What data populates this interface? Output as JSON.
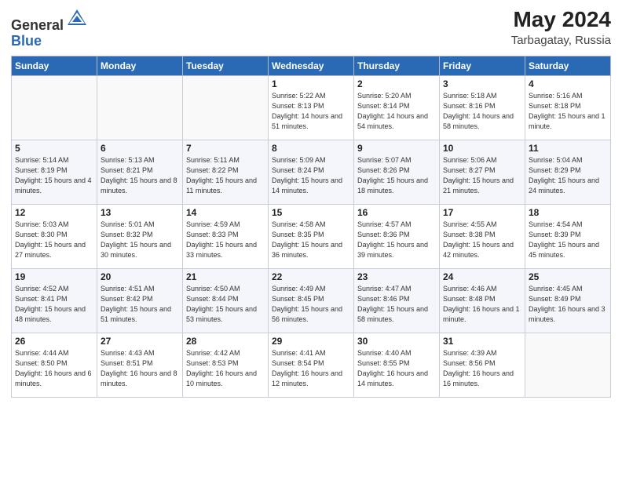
{
  "header": {
    "logo_general": "General",
    "logo_blue": "Blue",
    "month": "May 2024",
    "location": "Tarbagatay, Russia"
  },
  "days_of_week": [
    "Sunday",
    "Monday",
    "Tuesday",
    "Wednesday",
    "Thursday",
    "Friday",
    "Saturday"
  ],
  "weeks": [
    [
      {
        "day": "",
        "content": ""
      },
      {
        "day": "",
        "content": ""
      },
      {
        "day": "",
        "content": ""
      },
      {
        "day": "1",
        "content": "Sunrise: 5:22 AM\nSunset: 8:13 PM\nDaylight: 14 hours\nand 51 minutes."
      },
      {
        "day": "2",
        "content": "Sunrise: 5:20 AM\nSunset: 8:14 PM\nDaylight: 14 hours\nand 54 minutes."
      },
      {
        "day": "3",
        "content": "Sunrise: 5:18 AM\nSunset: 8:16 PM\nDaylight: 14 hours\nand 58 minutes."
      },
      {
        "day": "4",
        "content": "Sunrise: 5:16 AM\nSunset: 8:18 PM\nDaylight: 15 hours\nand 1 minute."
      }
    ],
    [
      {
        "day": "5",
        "content": "Sunrise: 5:14 AM\nSunset: 8:19 PM\nDaylight: 15 hours\nand 4 minutes."
      },
      {
        "day": "6",
        "content": "Sunrise: 5:13 AM\nSunset: 8:21 PM\nDaylight: 15 hours\nand 8 minutes."
      },
      {
        "day": "7",
        "content": "Sunrise: 5:11 AM\nSunset: 8:22 PM\nDaylight: 15 hours\nand 11 minutes."
      },
      {
        "day": "8",
        "content": "Sunrise: 5:09 AM\nSunset: 8:24 PM\nDaylight: 15 hours\nand 14 minutes."
      },
      {
        "day": "9",
        "content": "Sunrise: 5:07 AM\nSunset: 8:26 PM\nDaylight: 15 hours\nand 18 minutes."
      },
      {
        "day": "10",
        "content": "Sunrise: 5:06 AM\nSunset: 8:27 PM\nDaylight: 15 hours\nand 21 minutes."
      },
      {
        "day": "11",
        "content": "Sunrise: 5:04 AM\nSunset: 8:29 PM\nDaylight: 15 hours\nand 24 minutes."
      }
    ],
    [
      {
        "day": "12",
        "content": "Sunrise: 5:03 AM\nSunset: 8:30 PM\nDaylight: 15 hours\nand 27 minutes."
      },
      {
        "day": "13",
        "content": "Sunrise: 5:01 AM\nSunset: 8:32 PM\nDaylight: 15 hours\nand 30 minutes."
      },
      {
        "day": "14",
        "content": "Sunrise: 4:59 AM\nSunset: 8:33 PM\nDaylight: 15 hours\nand 33 minutes."
      },
      {
        "day": "15",
        "content": "Sunrise: 4:58 AM\nSunset: 8:35 PM\nDaylight: 15 hours\nand 36 minutes."
      },
      {
        "day": "16",
        "content": "Sunrise: 4:57 AM\nSunset: 8:36 PM\nDaylight: 15 hours\nand 39 minutes."
      },
      {
        "day": "17",
        "content": "Sunrise: 4:55 AM\nSunset: 8:38 PM\nDaylight: 15 hours\nand 42 minutes."
      },
      {
        "day": "18",
        "content": "Sunrise: 4:54 AM\nSunset: 8:39 PM\nDaylight: 15 hours\nand 45 minutes."
      }
    ],
    [
      {
        "day": "19",
        "content": "Sunrise: 4:52 AM\nSunset: 8:41 PM\nDaylight: 15 hours\nand 48 minutes."
      },
      {
        "day": "20",
        "content": "Sunrise: 4:51 AM\nSunset: 8:42 PM\nDaylight: 15 hours\nand 51 minutes."
      },
      {
        "day": "21",
        "content": "Sunrise: 4:50 AM\nSunset: 8:44 PM\nDaylight: 15 hours\nand 53 minutes."
      },
      {
        "day": "22",
        "content": "Sunrise: 4:49 AM\nSunset: 8:45 PM\nDaylight: 15 hours\nand 56 minutes."
      },
      {
        "day": "23",
        "content": "Sunrise: 4:47 AM\nSunset: 8:46 PM\nDaylight: 15 hours\nand 58 minutes."
      },
      {
        "day": "24",
        "content": "Sunrise: 4:46 AM\nSunset: 8:48 PM\nDaylight: 16 hours\nand 1 minute."
      },
      {
        "day": "25",
        "content": "Sunrise: 4:45 AM\nSunset: 8:49 PM\nDaylight: 16 hours\nand 3 minutes."
      }
    ],
    [
      {
        "day": "26",
        "content": "Sunrise: 4:44 AM\nSunset: 8:50 PM\nDaylight: 16 hours\nand 6 minutes."
      },
      {
        "day": "27",
        "content": "Sunrise: 4:43 AM\nSunset: 8:51 PM\nDaylight: 16 hours\nand 8 minutes."
      },
      {
        "day": "28",
        "content": "Sunrise: 4:42 AM\nSunset: 8:53 PM\nDaylight: 16 hours\nand 10 minutes."
      },
      {
        "day": "29",
        "content": "Sunrise: 4:41 AM\nSunset: 8:54 PM\nDaylight: 16 hours\nand 12 minutes."
      },
      {
        "day": "30",
        "content": "Sunrise: 4:40 AM\nSunset: 8:55 PM\nDaylight: 16 hours\nand 14 minutes."
      },
      {
        "day": "31",
        "content": "Sunrise: 4:39 AM\nSunset: 8:56 PM\nDaylight: 16 hours\nand 16 minutes."
      },
      {
        "day": "",
        "content": ""
      }
    ]
  ]
}
